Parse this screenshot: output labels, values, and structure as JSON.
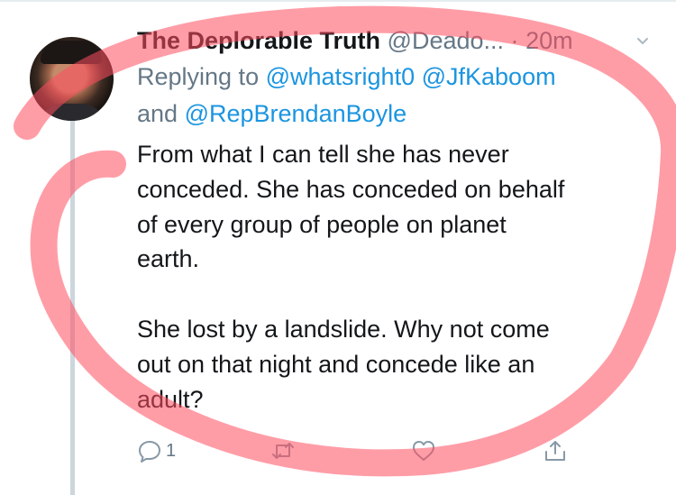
{
  "tweet": {
    "display_name": "The Deplorable Truth",
    "handle": "@Deado...",
    "separator": "·",
    "time": "20m",
    "reply_prefix": "Replying to",
    "mentions": [
      "@whatsright0",
      "@JfKaboom",
      "@RepBrendanBoyle"
    ],
    "mention_joiner": "and",
    "body": [
      "From what I can tell she has never",
      "conceded. She has conceded on behalf",
      "of every group of people on planet",
      "earth.",
      "She lost by a landslide. Why not come",
      "out on that night and concede like an",
      "adult?"
    ]
  },
  "actions": {
    "reply_icon": "reply-icon",
    "reply_count": "1",
    "retweet_icon": "retweet-icon",
    "like_icon": "heart-icon",
    "share_icon": "share-icon"
  },
  "colors": {
    "text": "#14171a",
    "muted": "#657786",
    "link": "#1b95e0",
    "thread_line": "#ccd6dd",
    "annotation": "#ff4d5e"
  }
}
